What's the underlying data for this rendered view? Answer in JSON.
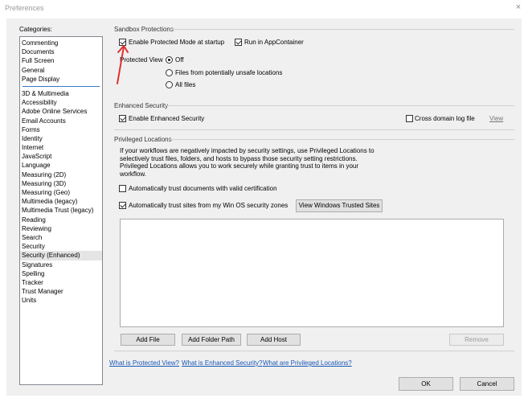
{
  "window": {
    "title": "Preferences",
    "close_glyph": "×"
  },
  "categories": {
    "label": "Categories:",
    "top_items": [
      "Commenting",
      "Documents",
      "Full Screen",
      "General",
      "Page Display"
    ],
    "items": [
      "3D & Multimedia",
      "Accessibility",
      "Adobe Online Services",
      "Email Accounts",
      "Forms",
      "Identity",
      "Internet",
      "JavaScript",
      "Language",
      "Measuring (2D)",
      "Measuring (3D)",
      "Measuring (Geo)",
      "Multimedia (legacy)",
      "Multimedia Trust (legacy)",
      "Reading",
      "Reviewing",
      "Search",
      "Security",
      "Security (Enhanced)",
      "Signatures",
      "Spelling",
      "Tracker",
      "Trust Manager",
      "Units"
    ],
    "selected": "Security (Enhanced)"
  },
  "sandbox": {
    "title": "Sandbox Protections",
    "protected_mode_label": "Enable Protected Mode at startup",
    "protected_mode_checked": true,
    "appcontainer_label": "Run in AppContainer",
    "appcontainer_checked": true,
    "protected_view_label": "Protected View",
    "pv_options": [
      "Off",
      "Files from potentially unsafe locations",
      "All files"
    ],
    "pv_selected": "Off"
  },
  "enhanced": {
    "title": "Enhanced Security",
    "enable_label": "Enable Enhanced Security",
    "enable_checked": true,
    "cross_domain_label": "Cross domain log file",
    "cross_domain_checked": false,
    "view_link": "View"
  },
  "privileged": {
    "title": "Privileged Locations",
    "description": "If your workflows are negatively impacted by security settings, use Privileged Locations to selectively trust files, folders, and hosts to bypass those security setting restrictions. Privileged Locations allows you to work securely while granting trust to items in your workflow.",
    "desc_lines": [
      "If your workflows are negatively impacted by security settings, use Privileged Locations to",
      "selectively trust files, folders, and hosts to bypass those security setting restrictions.",
      "Privileged Locations allows you to work securely while granting trust to items in your",
      "workflow."
    ],
    "trust_cert_label": "Automatically trust documents with valid certification",
    "trust_cert_checked": false,
    "trust_sites_label": "Automatically trust sites from my Win OS security zones",
    "trust_sites_checked": true,
    "view_sites_button": "View Windows Trusted Sites",
    "add_file": "Add File",
    "add_folder": "Add Folder Path",
    "add_host": "Add Host",
    "remove": "Remove"
  },
  "links": {
    "protected_view": "What is Protected View?",
    "enhanced_security": "What is Enhanced Security?",
    "privileged_locations": "What are Privileged Locations?"
  },
  "footer": {
    "ok": "OK",
    "cancel": "Cancel"
  },
  "colors": {
    "annotation_arrow": "#e03030",
    "link": "#1a57b8",
    "dialog_bg": "#f0f0f0"
  }
}
